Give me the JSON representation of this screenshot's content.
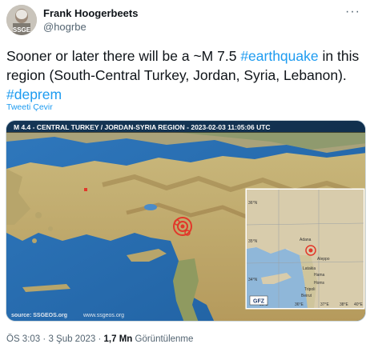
{
  "author": {
    "name": "Frank Hoogerbeets",
    "handle": "@hogrbe",
    "avatar_text": "SSGE"
  },
  "tweet": {
    "text_parts": {
      "p1": "Sooner or later there will be a ~M 7.5 ",
      "h1": "#earthquake",
      "p2": " in this region (South-Central Turkey, Jordan, Syria, Lebanon). ",
      "h2": "#deprem"
    },
    "translate_label": "Tweeti Çevir"
  },
  "media": {
    "title": "M 4.4 - CENTRAL TURKEY / JORDAN-SYRIA REGION - 2023-02-03 11:05:06 UTC",
    "source": "source: SSGEOS.org",
    "website": "www.ssgeos.org",
    "inset": {
      "logo": "GFZ",
      "lat_labels": [
        "36°N",
        "35°N",
        "34°N"
      ],
      "lon_labels": [
        "35°E",
        "36°E",
        "37°E",
        "38°E",
        "40°E"
      ],
      "cities": [
        "Adana",
        "Aleppo",
        "Latakia",
        "Hama",
        "Homs",
        "Tripoli",
        "Beirut"
      ]
    }
  },
  "meta": {
    "time": "ÖS 3:03",
    "separator": " · ",
    "date": "3 Şub 2023",
    "views_count": "1,7 Mn",
    "views_label": "Görüntülenme"
  },
  "colors": {
    "hashtag": "#1d9bf0",
    "text": "#0f1419",
    "secondary": "#536471"
  }
}
